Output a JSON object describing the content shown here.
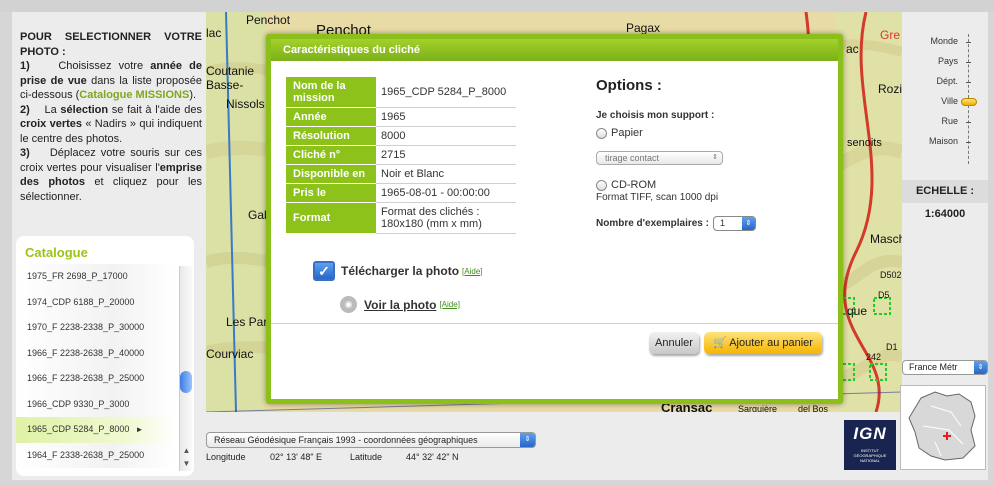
{
  "instructions": {
    "title": "POUR SELECTIONNER VOTRE PHOTO :",
    "step1_num": "1)",
    "step1_a": "Choisissez votre ",
    "step1_b": "année de prise de vue",
    "step1_c": " dans la liste proposée ci-dessous (",
    "step1_d": "Catalogue MISSIONS",
    "step1_e": ").",
    "step2_num": "2)",
    "step2_a": "La ",
    "step2_b": "sélection",
    "step2_c": " se fait à l'aide des ",
    "step2_d": "croix vertes",
    "step2_e": " « Nadirs » qui indiquent le centre des photos.",
    "step3_num": "3)",
    "step3_a": "Déplacez votre souris sur ces croix vertes pour visualiser l'",
    "step3_b": "emprise des photos",
    "step3_c": " et cliquez pour les sélectionner."
  },
  "catalogue": {
    "title": "Catalogue",
    "items": [
      "1975_FR 2698_P_17000",
      "1974_CDP 6188_P_20000",
      "1970_F 2238-2338_P_30000",
      "1966_F 2238-2638_P_40000",
      "1966_F 2238-2638_P_25000",
      "1966_CDP 9330_P_3000",
      "1965_CDP 5284_P_8000",
      "1964_F 2338-2638_P_25000"
    ],
    "selected_index": 6
  },
  "map": {
    "places": [
      "Penchot",
      "Penchot",
      "Pagax",
      "lac",
      "Coutanie",
      "Basse-",
      "Nissols",
      "Gab",
      "Les Parr",
      "Courviac",
      "Cransac",
      "Sarguière",
      "del Bos",
      "Rozi",
      "senoits",
      "Masch",
      "que",
      "D502",
      "D5",
      "Gre",
      "ac",
      "242",
      "D1"
    ]
  },
  "modal": {
    "title": "Caractéristiques du cliché",
    "rows": [
      {
        "key": "Nom de la mission",
        "value": "1965_CDP 5284_P_8000"
      },
      {
        "key": "Année",
        "value": "1965"
      },
      {
        "key": "Résolution",
        "value": "8000"
      },
      {
        "key": "Cliché n°",
        "value": "2715"
      },
      {
        "key": "Disponible en",
        "value": "Noir et Blanc"
      },
      {
        "key": "Pris le",
        "value": "1965-08-01 - 00:00:00"
      },
      {
        "key": "Format",
        "value": "Format des clichés : 180x180 (mm x mm)"
      }
    ],
    "download_label": "Télécharger la photo",
    "aide": "[Aide]",
    "view_label": "Voir la photo",
    "options_title": "Options :",
    "support_label": "Je choisis mon support :",
    "papier": "Papier",
    "tirage": "tirage contact",
    "cdrom": "CD-ROM",
    "cdrom_desc": "Format TIFF, scan 1000 dpi",
    "qty_label": "Nombre d'exemplaires :",
    "qty_value": "1",
    "cancel": "Annuler",
    "add_cart": "Ajouter au panier"
  },
  "coords": {
    "projection": "Réseau Géodésique Français 1993 - coordonnées géographiques",
    "lon_label": "Longitude",
    "lon_value": "02° 13' 48\" E",
    "lat_label": "Latitude",
    "lat_value": "44° 32' 42\" N"
  },
  "ign": {
    "logo": "IGN",
    "sub1": "INSTITUT",
    "sub2": "GÉOGRAPHIQUE",
    "sub3": "NATIONAL"
  },
  "zoom": {
    "levels": [
      "Monde",
      "Pays",
      "Dépt.",
      "Ville",
      "Rue",
      "Maison"
    ],
    "active": "Ville"
  },
  "scale": {
    "label": "ECHELLE :",
    "value": "1:64000"
  },
  "region": "France Métr",
  "colors": {
    "accent": "#8cc21a",
    "button_yellow": "#f5b400",
    "ign_blue": "#1a2450"
  }
}
